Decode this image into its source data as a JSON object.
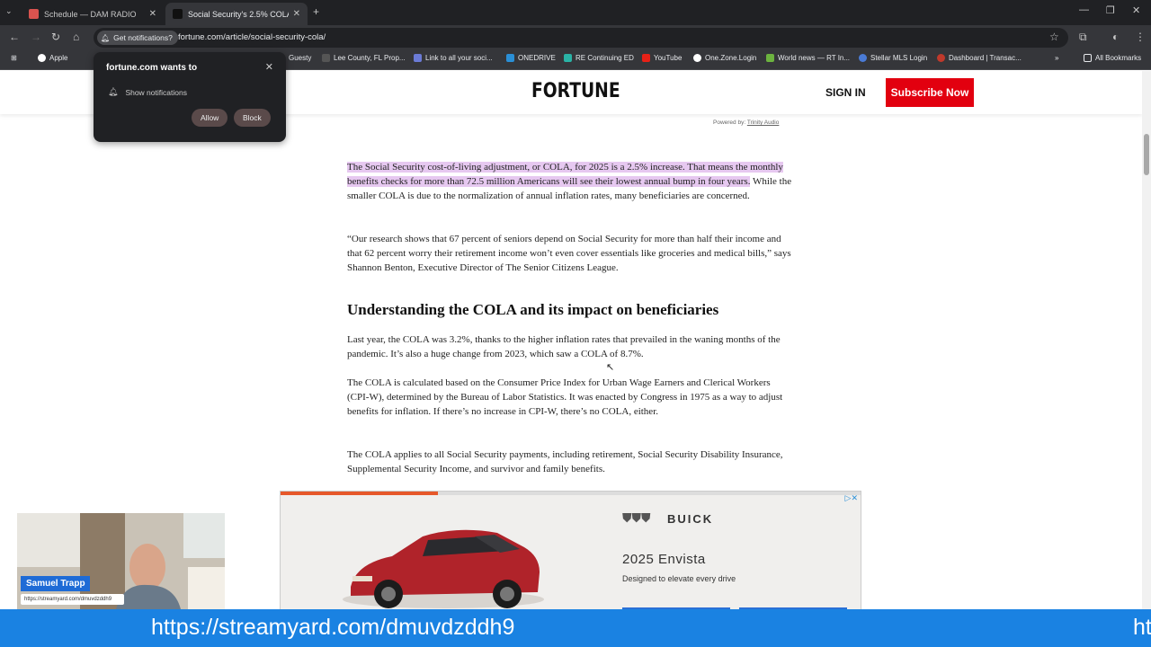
{
  "browser": {
    "tabs": [
      {
        "title": "Schedule — DAM RADIO",
        "active": false
      },
      {
        "title": "Social Security's 2.5% COLA inc",
        "active": true
      }
    ],
    "new_tab": "+",
    "notification_chip": "Get notifications?",
    "url": "fortune.com/article/social-security-cola/",
    "bookmarks": [
      {
        "label": "Apple",
        "icon": "apple-icon"
      },
      {
        "label": "Guesty",
        "icon": "guesty-icon"
      },
      {
        "label": "Lee County, FL Prop...",
        "icon": "lee-county-icon"
      },
      {
        "label": "Link to all your soci...",
        "icon": "link-icon"
      },
      {
        "label": "ONEDRIVE",
        "icon": "onedrive-icon"
      },
      {
        "label": "RE Continuing ED",
        "icon": "re-continuing-icon"
      },
      {
        "label": "YouTube",
        "icon": "youtube-icon"
      },
      {
        "label": "One.Zone.Login",
        "icon": "onezone-icon"
      },
      {
        "label": "World news — RT In...",
        "icon": "rt-icon"
      },
      {
        "label": "Stellar MLS Login",
        "icon": "stellar-icon"
      },
      {
        "label": "Dashboard | Transac...",
        "icon": "dashboard-icon"
      }
    ],
    "all_bookmarks": "All Bookmarks"
  },
  "popup": {
    "title": "fortune.com wants to",
    "permission": "Show notifications",
    "allow": "Allow",
    "block": "Block"
  },
  "site": {
    "logo": "FORTUNE",
    "sign_in": "SIGN IN",
    "subscribe": "Subscribe Now",
    "powered_by": "Powered by:",
    "powered_by_link": "Trinity Audio"
  },
  "article": {
    "p1_highlight": "The Social Security cost-of-living adjustment, or COLA, for 2025 is a 2.5% increase. That means the monthly benefits checks for more than 72.5 million Americans will see their lowest annual bump in four years.",
    "p1_rest": " While the smaller COLA is due to the normalization of annual inflation rates, many beneficiaries are concerned.",
    "p2": "“Our research shows that 67 percent of seniors depend on Social Security for more than half their income and that 62 percent worry their retirement income won’t even cover essentials like groceries and medical bills,” says Shannon Benton, Executive Director of The Senior Citizens League.",
    "heading": "Understanding the COLA and its impact on beneficiaries",
    "p3": "Last year, the COLA was 3.2%, thanks to the higher inflation rates that prevailed in the waning months of the pandemic. It’s also a huge change from 2023, which saw a COLA of 8.7%.",
    "p4": "The COLA is calculated based on the Consumer Price Index for Urban Wage Earners and Clerical Workers (CPI-W), determined by the Bureau of Labor Statistics. It was enacted by Congress in 1975 as a way to adjust benefits for inflation. If there’s no increase in CPI-W, there’s no COLA, either.",
    "p5": "The COLA applies to all Social Security payments, including retirement, Social Security Disability Insurance, Supplemental Security Income, and survivor and family benefits."
  },
  "ad": {
    "brand": "BUICK",
    "model": "2025 Envista",
    "tagline": "Designed to elevate every drive",
    "progress": 0.27
  },
  "webcam": {
    "name": "Samuel Trapp",
    "url": "https://streamyard.com/dmuvdzddh9"
  },
  "banner": {
    "text": "https://streamyard.com/dmuvdzddh9",
    "text_repeat": "ht"
  }
}
